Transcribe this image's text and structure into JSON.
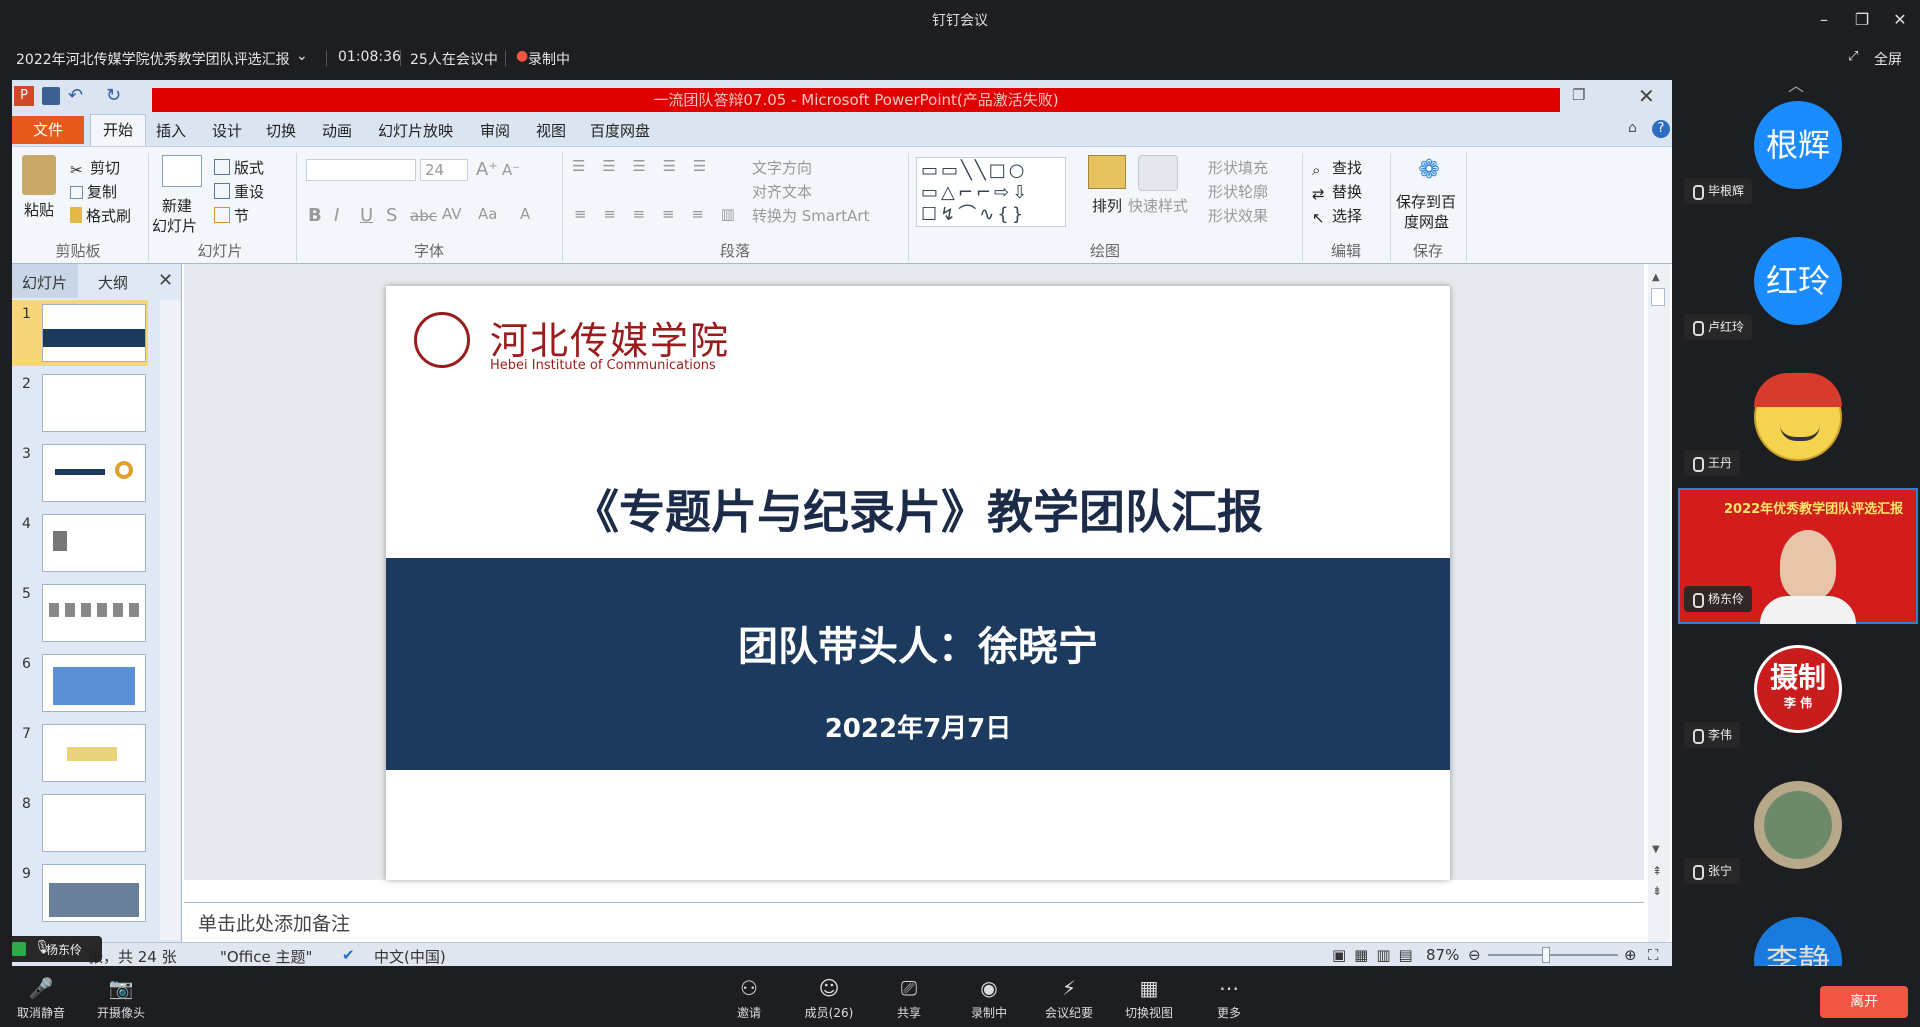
{
  "app": {
    "title": "钉钉会议"
  },
  "meeting": {
    "title": "2022年河北传媒学院优秀教学团队评选汇报",
    "duration": "01:08:36",
    "attendees": "25人在会议中",
    "recording": "录制中",
    "fullscreen": "全屏"
  },
  "ppt": {
    "window_title": "一流团队答辩07.05 - Microsoft PowerPoint(产品激活失败)",
    "tabs": [
      "文件",
      "开始",
      "插入",
      "设计",
      "切换",
      "动画",
      "幻灯片放映",
      "审阅",
      "视图",
      "百度网盘"
    ],
    "ribbon": {
      "paste": "粘贴",
      "cut": "剪切",
      "copy": "复制",
      "format_painter": "格式刷",
      "clipboard": "剪贴板",
      "new_slide_1": "新建",
      "new_slide_2": "幻灯片",
      "layout": "版式",
      "reset": "重设",
      "section": "节",
      "slides": "幻灯片",
      "font_size": "24",
      "font": "字体",
      "text_direction": "文字方向",
      "align_text": "对齐文本",
      "smartart": "转换为 SmartArt",
      "paragraph": "段落",
      "arrange": "排列",
      "quick_styles": "快速样式",
      "shape_fill": "形状填充",
      "shape_outline": "形状轮廓",
      "shape_effects": "形状效果",
      "drawing": "绘图",
      "find": "查找",
      "replace": "替换",
      "select": "选择",
      "editing": "编辑",
      "save_baidu_1": "保存到百",
      "save_baidu_2": "度网盘",
      "save": "保存"
    },
    "pane_tabs": [
      "幻灯片",
      "大纲"
    ],
    "thumbnails": [
      "1",
      "2",
      "3",
      "4",
      "5",
      "6",
      "7",
      "8",
      "9"
    ],
    "slide": {
      "school_cn": "河北传媒学院",
      "school_en": "Hebei Institute of Communications",
      "title": "《专题片与纪录片》教学团队汇报",
      "leader": "团队带头人：徐晓宁",
      "date": "2022年7月7日"
    },
    "notes_placeholder": "单击此处添加备注",
    "status": {
      "slide_info": "张，共 24 张",
      "theme": "\"Office 主题\"",
      "language": "中文(中国)",
      "zoom": "87%"
    },
    "colors": {
      "title_bar": "#e00000",
      "band": "#1b3a5e",
      "file_tab": "#e55a1b"
    }
  },
  "speaker_badge": "杨东伶",
  "participants": [
    {
      "name": "毕根辉",
      "avatar_text": "根辉",
      "type": "text"
    },
    {
      "name": "卢红玲",
      "avatar_text": "红玲",
      "type": "text"
    },
    {
      "name": "王丹",
      "avatar_text": "",
      "type": "cartoon"
    },
    {
      "name": "杨东伶",
      "avatar_text": "",
      "type": "video",
      "banner": "2022年优秀教学团队评选汇报"
    },
    {
      "name": "李伟",
      "avatar_text": "摄制",
      "sub": "李 伟",
      "type": "seal"
    },
    {
      "name": "张宁",
      "avatar_text": "",
      "type": "photo"
    },
    {
      "name": "",
      "avatar_text": "李静",
      "type": "text"
    }
  ],
  "toolbar": {
    "mute": "取消静音",
    "camera": "开摄像头",
    "invite": "邀请",
    "members": "成员(26)",
    "share": "共享",
    "recording": "录制中",
    "minutes": "会议纪要",
    "switch_view": "切换视图",
    "more": "更多",
    "leave": "离开"
  }
}
